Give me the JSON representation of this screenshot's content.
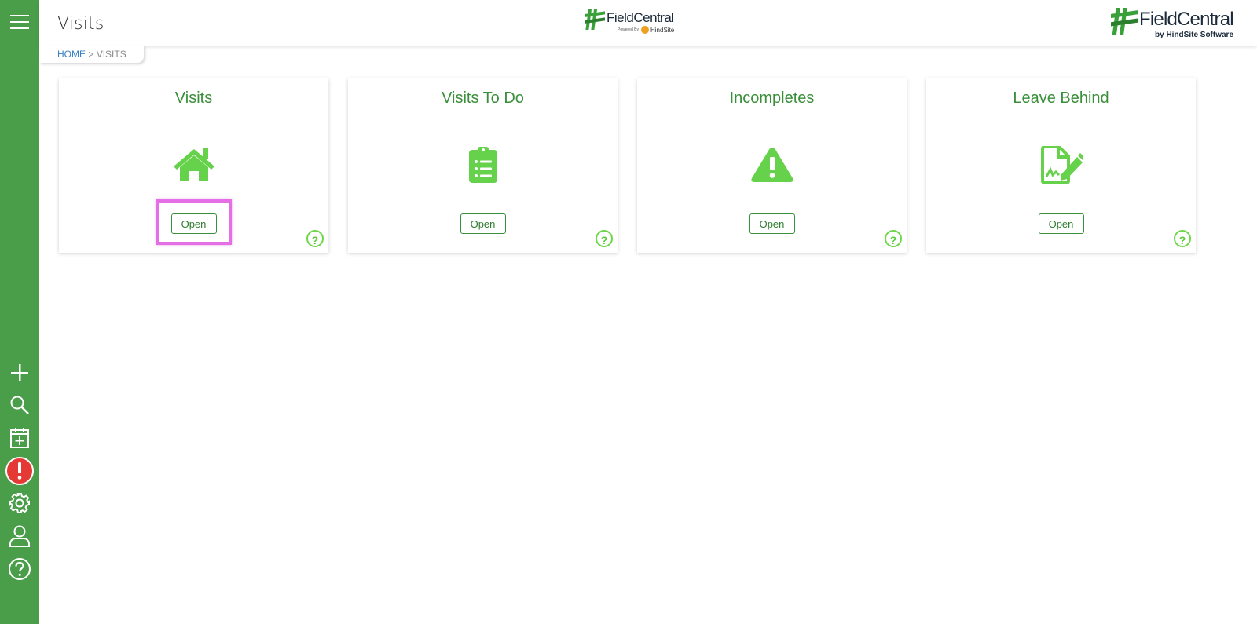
{
  "header": {
    "title": "Visits"
  },
  "breadcrumb": {
    "home": "HOME",
    "separator": ">",
    "current": "VISITS"
  },
  "logos": {
    "center": {
      "brand": "FieldCentral",
      "powered": "Powered By",
      "sub": "HindSite"
    },
    "right": {
      "brand": "FieldCentral",
      "by": "by HindSite Software"
    }
  },
  "sidebar": {
    "items": [
      {
        "icon": "menu-icon"
      },
      {
        "icon": "plus-icon"
      },
      {
        "icon": "search-icon"
      },
      {
        "icon": "calendar-add-icon"
      },
      {
        "icon": "alert-icon"
      },
      {
        "icon": "gear-icon"
      },
      {
        "icon": "user-icon"
      },
      {
        "icon": "help-icon"
      }
    ]
  },
  "cards": [
    {
      "title": "Visits",
      "icon": "home-icon",
      "button": "Open",
      "help": "?"
    },
    {
      "title": "Visits To Do",
      "icon": "clipboard-list-icon",
      "button": "Open",
      "help": "?"
    },
    {
      "title": "Incompletes",
      "icon": "warning-icon",
      "button": "Open",
      "help": "?"
    },
    {
      "title": "Leave Behind",
      "icon": "file-signature-icon",
      "button": "Open",
      "help": "?"
    }
  ],
  "colors": {
    "sidebar": "#4a9e4a",
    "accent": "#3a8f3a",
    "icon_green": "#66d14a",
    "alert_red": "#e53935",
    "highlight": "#e56ee6"
  }
}
